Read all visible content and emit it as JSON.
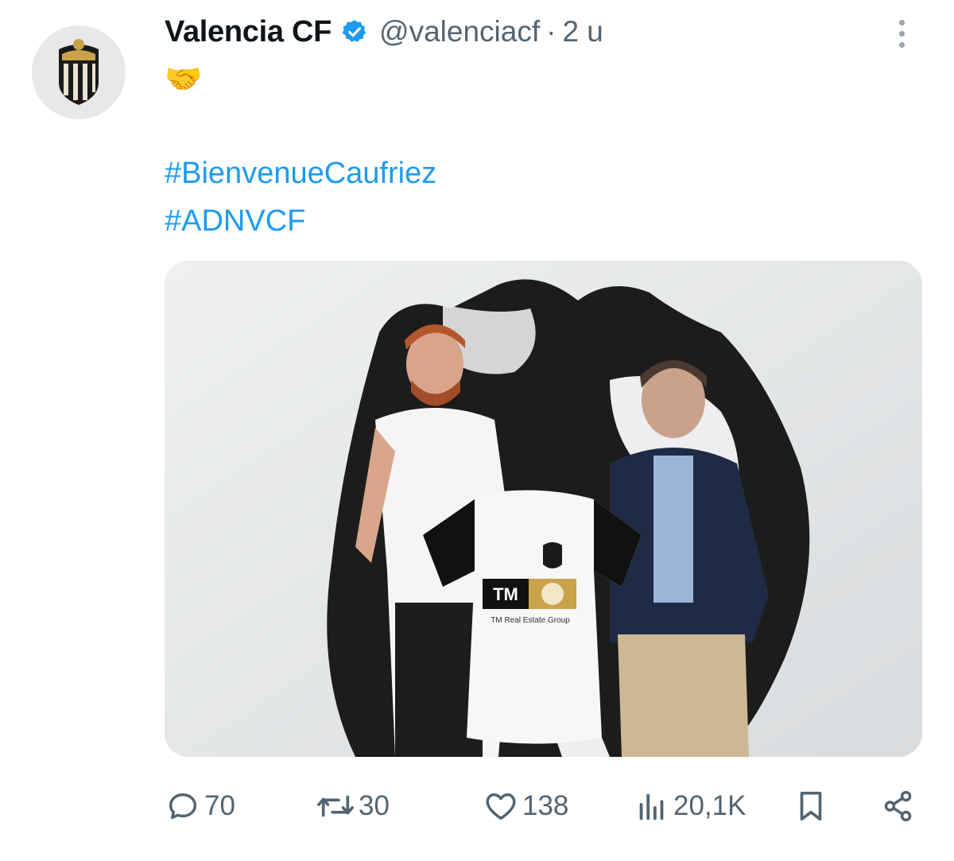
{
  "tweet": {
    "display_name": "Valencia CF",
    "verified_badge": "verified-badge-icon",
    "handle": "@valenciacf",
    "separator": "·",
    "time": "2 u",
    "emoji": "🤝",
    "hashtags": [
      "#BienvenueCaufriez",
      "#ADNVCF"
    ],
    "media": {
      "jersey_sponsor": "TM",
      "jersey_sponsor_sub": "TM Real Estate Group"
    }
  },
  "actions": {
    "replies": "70",
    "retweets": "30",
    "likes": "138",
    "views": "20,1K"
  },
  "colors": {
    "link": "#1d9bf0",
    "muted": "#536471",
    "verified": "#1d9bf0",
    "text": "#0f1419"
  }
}
